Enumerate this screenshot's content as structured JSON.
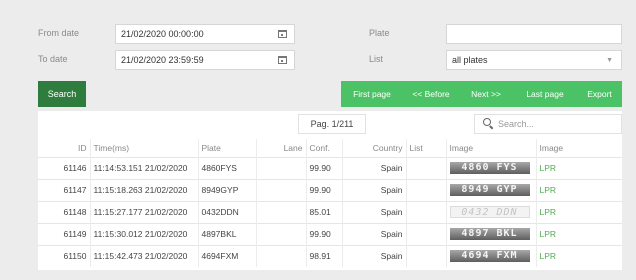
{
  "filters": {
    "from_label": "From date",
    "from_value": "21/02/2020 00:00:00",
    "to_label": "To date",
    "to_value": "21/02/2020 23:59:59",
    "plate_label": "Plate",
    "plate_value": "",
    "list_label": "List",
    "list_value": "all plates",
    "list_caret": "▼"
  },
  "buttons": {
    "search": "Search",
    "first": "First page",
    "before": "<< Before",
    "next": "Next >>",
    "last": "Last page",
    "export": "Export"
  },
  "pagination": {
    "label": "Pag. 1/211"
  },
  "search": {
    "placeholder": "Search..."
  },
  "table": {
    "headers": [
      "ID",
      "Time(ms)",
      "Plate",
      "Lane",
      "Conf.",
      "Country",
      "List",
      "Image",
      "Image"
    ],
    "rows": [
      {
        "id": "61146",
        "time": "11:14:53.151 21/02/2020",
        "plate": "4860FYS",
        "lane": "",
        "conf": "99.90",
        "country": "Spain",
        "list": "",
        "image_text": "4860 FYS",
        "link": "LPR"
      },
      {
        "id": "61147",
        "time": "11:15:18.263 21/02/2020",
        "plate": "8949GYP",
        "lane": "",
        "conf": "99.90",
        "country": "Spain",
        "list": "",
        "image_text": "8949 GYP",
        "link": "LPR"
      },
      {
        "id": "61148",
        "time": "11:15:27.177 21/02/2020",
        "plate": "0432DDN",
        "lane": "",
        "conf": "85.01",
        "country": "Spain",
        "list": "",
        "image_text": "0432 DDN",
        "link": "LPR"
      },
      {
        "id": "61149",
        "time": "11:15:30.012 21/02/2020",
        "plate": "4897BKL",
        "lane": "",
        "conf": "99.90",
        "country": "Spain",
        "list": "",
        "image_text": "4897 BKL",
        "link": "LPR"
      },
      {
        "id": "61150",
        "time": "11:15:42.473 21/02/2020",
        "plate": "4694FXM",
        "lane": "",
        "conf": "98.91",
        "country": "Spain",
        "list": "",
        "image_text": "4694 FXM",
        "link": "LPR"
      }
    ]
  },
  "colors": {
    "green": "#4cc266",
    "dark_green": "#2e7d3e",
    "link_green": "#4cae4c",
    "background": "#ececec"
  }
}
